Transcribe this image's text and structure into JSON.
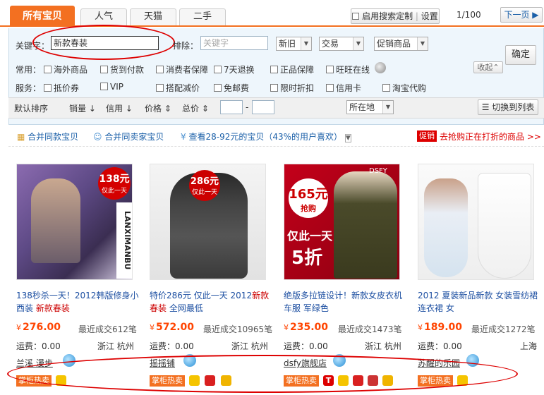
{
  "tabs": [
    {
      "label": "所有宝贝",
      "active": true
    },
    {
      "label": "人气"
    },
    {
      "label": "天猫"
    },
    {
      "label": "二手"
    }
  ],
  "custom_search": {
    "checkbox_label": "启用搜索定制",
    "settings_label": "设置"
  },
  "pager": {
    "page_text": "1/100",
    "next_label": "下一页 "
  },
  "search": {
    "keyword_label": "关键字：",
    "keyword_value": "新款春装",
    "exclude_label": "排除：",
    "exclude_placeholder": "关键字",
    "condition": "新旧",
    "trade": "交易",
    "promo": "促销商品",
    "confirm_label": "确定"
  },
  "filters": {
    "common_label": "常用：",
    "service_label": "服务：",
    "collapse_label": "收起",
    "common": [
      "海外商品",
      "货到付款",
      "消费者保障",
      "7天退换",
      "正品保障",
      "旺旺在线"
    ],
    "service": [
      "抵价券",
      "VIP",
      "搭配减价",
      "免邮费",
      "限时折扣",
      "信用卡",
      "淘宝代购"
    ]
  },
  "sort": {
    "default": "默认排序",
    "sales": "销量",
    "credit": "信用",
    "price": "价格",
    "total": "总价",
    "range_sep": "-",
    "location": "所在地",
    "list_view": "切换到列表"
  },
  "info": {
    "merge_same": "合并同款宝贝",
    "merge_seller": "合并同卖家宝贝",
    "price_tip": "查看28-92元的宝贝",
    "pct_tip": "（43%的用户喜欢）",
    "promo_badge": "促销",
    "promo_text": "去抢购正在打折的商品 >>"
  },
  "products": [
    {
      "title_a": "138秒杀一天！2012韩版修身小西装 ",
      "title_red": "新款春装",
      "title_b": "",
      "currency": "¥",
      "price": "276.00",
      "sales": "最近成交612笔",
      "ship": "运费：0.00",
      "loc": "浙江 杭州",
      "shop": "兰溪 漫步",
      "badge": "掌柜热卖",
      "promo_price": "138元",
      "promo_day": "仅此一天",
      "side_text": "LANXIMANBU"
    },
    {
      "title_a": "特价286元 仅此一天 2012",
      "title_red": "新款春装",
      "title_b": " 全网最低",
      "currency": "¥",
      "price": "572.00",
      "sales": "最近成交10965笔",
      "ship": "运费：0.00",
      "loc": "浙江 杭州",
      "shop": "摇摇铺",
      "badge": "掌柜热卖",
      "promo_price": "286元",
      "promo_day": "仅此一天"
    },
    {
      "title_a": "绝版多拉链设计！新款女皮衣机车服 军绿色",
      "title_red": "",
      "title_b": "",
      "currency": "¥",
      "price": "235.00",
      "sales": "最近成交1473笔",
      "ship": "运费：0.00",
      "loc": "浙江 杭州",
      "shop": "dsfy旗舰店",
      "badge": "掌柜热卖",
      "promo_price": "165元",
      "promo_buy": "抢购",
      "promo_day": "仅此一天",
      "promo_discount": "5折",
      "brand": "DSFY"
    },
    {
      "title_a": "2012 夏装新品新款 女装雪纺裙连衣裙 女",
      "title_red": "",
      "title_b": "",
      "currency": "¥",
      "price": "189.00",
      "sales": "最近成交1272笔",
      "ship": "运费：0.00",
      "loc": "上海",
      "shop": "苏醒的乐园",
      "badge": "掌柜热卖"
    }
  ]
}
